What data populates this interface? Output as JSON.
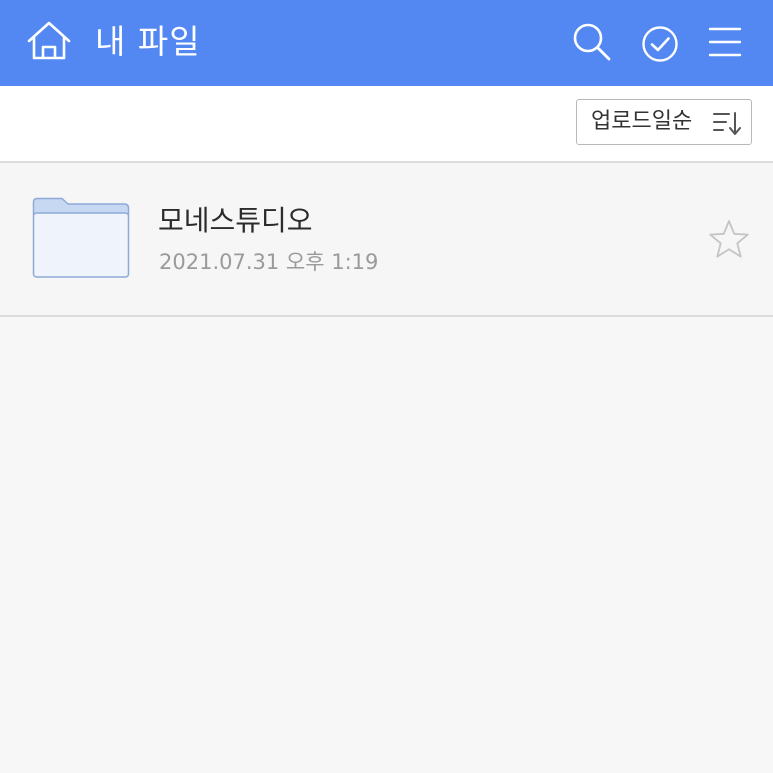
{
  "header": {
    "title": "내 파일",
    "background_color": "#5388f2",
    "icons": {
      "home": "home-icon",
      "search": "search-icon",
      "select": "check-circle-icon",
      "menu": "menu-icon"
    }
  },
  "toolbar": {
    "sort_label": "업로드일순",
    "sort_icon": "sort-descending-icon"
  },
  "files": [
    {
      "type": "folder",
      "icon": "folder-icon",
      "name": "모네스튜디오",
      "date": "2021.07.31 오후 1:19",
      "favorite": false
    }
  ]
}
